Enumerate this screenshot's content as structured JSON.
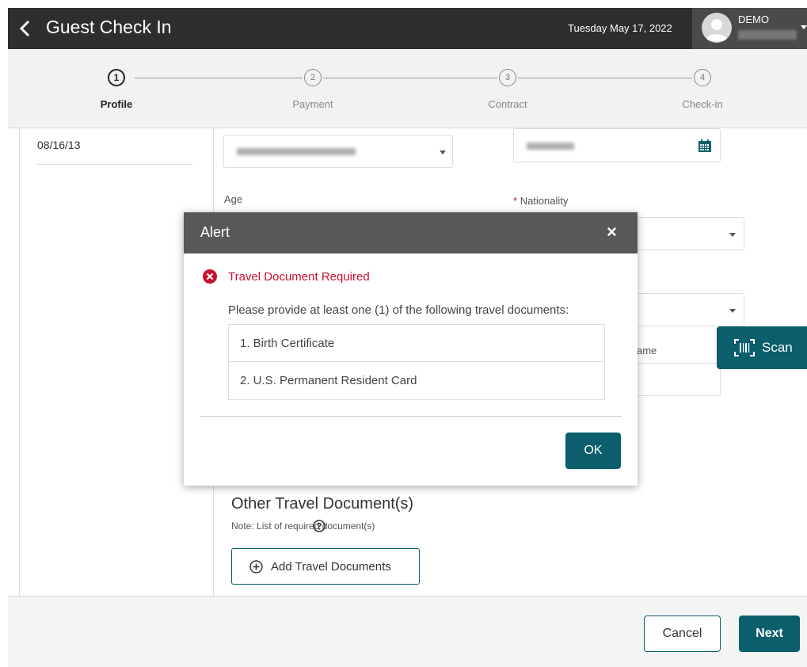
{
  "header": {
    "title": "Guest Check In",
    "date": "Tuesday May 17, 2022",
    "user": "DEMO"
  },
  "stepper": {
    "steps": [
      {
        "number": "1",
        "label": "Profile",
        "active": true
      },
      {
        "number": "2",
        "label": "Payment",
        "active": false
      },
      {
        "number": "3",
        "label": "Contract",
        "active": false
      },
      {
        "number": "4",
        "label": "Check-in",
        "active": false
      }
    ]
  },
  "left_panel": {
    "date_of_birth": "08/16/13"
  },
  "form": {
    "age_label": "Age",
    "nationality_label": "Nationality",
    "required_mark": "*",
    "partial_label": "ame"
  },
  "other_docs": {
    "title": "Other Travel Document(s)",
    "note": "Note: List of required document(s)",
    "add_button": "Add Travel Documents"
  },
  "scan": {
    "label": "Scan"
  },
  "footer": {
    "cancel": "Cancel",
    "next": "Next"
  },
  "alert": {
    "title": "Alert",
    "close": "×",
    "error_title": "Travel Document Required",
    "message": "Please provide at least one (1) of the following travel documents:",
    "documents": [
      "1. Birth Certificate",
      "2. U.S. Permanent Resident Card"
    ],
    "ok": "OK"
  },
  "colors": {
    "accent": "#0b5e6b",
    "error": "#c8102e",
    "header_bg": "#2e2e2e",
    "modal_head": "#585858"
  },
  "icons": [
    "chevron-left-icon",
    "user-avatar-icon",
    "calendar-icon",
    "error-circle-icon",
    "help-circle-icon",
    "plus-circle-icon",
    "barcode-scan-icon"
  ]
}
